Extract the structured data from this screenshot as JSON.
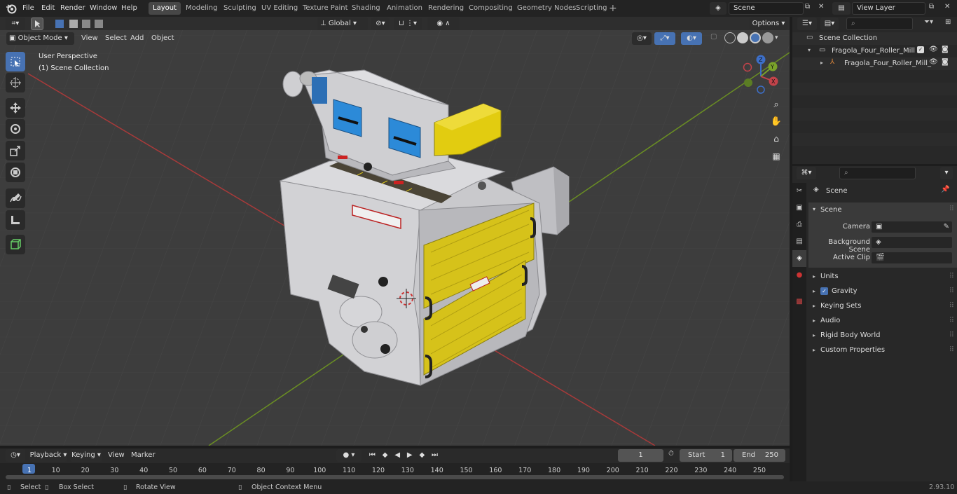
{
  "menus": [
    "File",
    "Edit",
    "Render",
    "Window",
    "Help"
  ],
  "workspaces": [
    "Layout",
    "Modeling",
    "Sculpting",
    "UV Editing",
    "Texture Paint",
    "Shading",
    "Animation",
    "Rendering",
    "Compositing",
    "Geometry Nodes",
    "Scripting"
  ],
  "active_workspace": "Layout",
  "scene_field": "Scene",
  "view_layer_field": "View Layer",
  "viewport": {
    "mode": "Object Mode",
    "menus": [
      "View",
      "Select",
      "Add",
      "Object"
    ],
    "orientation": "Global",
    "options": "Options",
    "overlay_title": "User Perspective",
    "overlay_collection": "(1) Scene Collection"
  },
  "outliner": {
    "root": "Scene Collection",
    "collection": "Fragola_Four_Roller_Mill",
    "object": "Fragola_Four_Roller_Mill_"
  },
  "properties": {
    "context_title": "Scene",
    "section": "Scene",
    "fields": [
      {
        "label": "Camera"
      },
      {
        "label": "Background Scene"
      },
      {
        "label": "Active Clip"
      }
    ],
    "panels": [
      "Units",
      "Gravity",
      "Keying Sets",
      "Audio",
      "Rigid Body World",
      "Custom Properties"
    ],
    "gravity_checked": true
  },
  "timeline": {
    "menus": [
      "Playback",
      "Keying",
      "View",
      "Marker"
    ],
    "current_frame": "1",
    "start_label": "Start",
    "start": "1",
    "end_label": "End",
    "end": "250",
    "ticks": [
      "1",
      "10",
      "20",
      "30",
      "40",
      "50",
      "60",
      "70",
      "80",
      "90",
      "100",
      "110",
      "120",
      "130",
      "140",
      "150",
      "160",
      "170",
      "180",
      "190",
      "200",
      "210",
      "220",
      "230",
      "240",
      "250"
    ]
  },
  "status": {
    "select": "Select",
    "box_select": "Box Select",
    "rotate": "Rotate View",
    "context_menu": "Object Context Menu",
    "version": "2.93.10"
  },
  "colors": {
    "accent": "#4772b3",
    "x_axis": "#a83a3a",
    "y_axis": "#6a8e23",
    "yellow": "#d6c21a",
    "blue_panel": "#2c8ad8"
  }
}
